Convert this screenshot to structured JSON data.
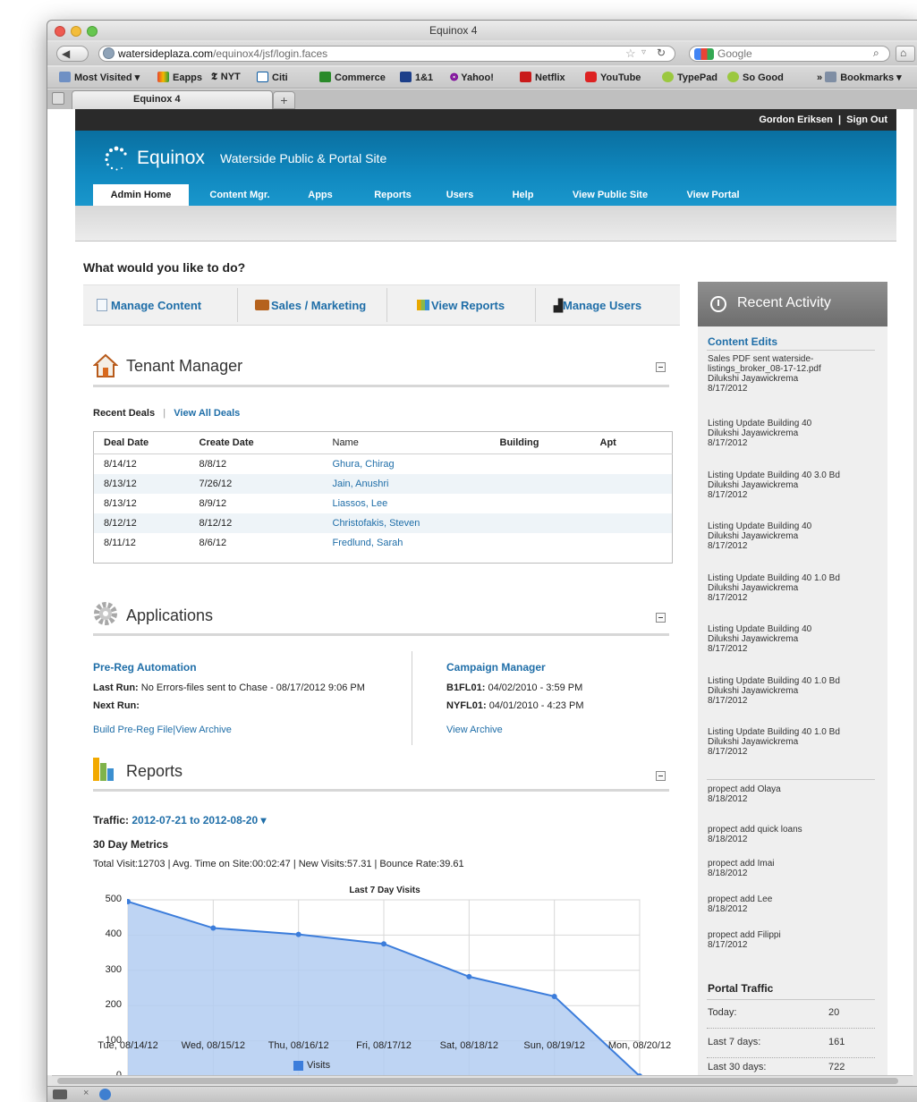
{
  "browser": {
    "window_title": "Equinox 4",
    "url_domain": "watersideplaza.com",
    "url_path": "/equinox4/jsf/login.faces",
    "search_engine": "Google",
    "tab_title": "Equinox 4",
    "bookmarks": [
      "Most Visited",
      "Eapps",
      "NYT",
      "Citi",
      "Commerce",
      "1&1",
      "Yahoo!",
      "Netflix",
      "YouTube",
      "TypePad",
      "So Good"
    ],
    "bookmarks_menu": "Bookmarks",
    "overflow": "»"
  },
  "topbar": {
    "user": "Gordon Eriksen",
    "separator": "|",
    "signout": "Sign Out"
  },
  "header": {
    "logo": "Equinox",
    "site_title": "Waterside Public & Portal Site"
  },
  "nav": [
    "Admin Home",
    "Content Mgr.",
    "Apps",
    "Reports",
    "Users",
    "Help",
    "View Public Site",
    "View Portal"
  ],
  "main": {
    "question": "What would you like to do?",
    "quick_actions": [
      "Manage Content",
      "Sales / Marketing",
      "View Reports",
      "Manage Users"
    ]
  },
  "tenant": {
    "title": "Tenant Manager",
    "recent_label": "Recent Deals",
    "sep": "|",
    "view_all": "View All Deals",
    "columns": [
      "Deal Date",
      "Create Date",
      "Name",
      "Building",
      "Apt"
    ],
    "rows": [
      {
        "deal": "8/14/12",
        "create": "8/8/12",
        "name": "Ghura, Chirag"
      },
      {
        "deal": "8/13/12",
        "create": "7/26/12",
        "name": "Jain, Anushri"
      },
      {
        "deal": "8/13/12",
        "create": "8/9/12",
        "name": "Liassos, Lee"
      },
      {
        "deal": "8/12/12",
        "create": "8/12/12",
        "name": "Christofakis, Steven"
      },
      {
        "deal": "8/11/12",
        "create": "8/6/12",
        "name": "Fredlund, Sarah"
      }
    ]
  },
  "apps": {
    "title": "Applications",
    "left": {
      "name": "Pre-Reg Automation",
      "last_run_label": "Last Run:",
      "last_run_value": "No Errors-files sent to Chase - 08/17/2012 9:06 PM",
      "next_run_label": "Next Run:",
      "link1": "Build Pre-Reg File",
      "pipe": "|",
      "link2": "View Archive"
    },
    "right": {
      "name": "Campaign Manager",
      "line1_label": "B1FL01:",
      "line1_value": "04/02/2010 - 3:59 PM",
      "line2_label": "NYFL01:",
      "line2_value": "04/01/2010 - 4:23 PM",
      "link": "View Archive"
    }
  },
  "reports": {
    "title": "Reports",
    "traffic_label": "Traffic:",
    "traffic_range": "2012-07-21 to 2012-08-20 ▾",
    "metrics_title": "30 Day Metrics",
    "metrics_line": "Total Visit:12703 | Avg. Time on Site:00:02:47 | New Visits:57.31 | Bounce Rate:39.61"
  },
  "chart_data": {
    "type": "area",
    "title": "Last 7 Day Visits",
    "categories": [
      "Tue, 08/14/12",
      "Wed, 08/15/12",
      "Thu, 08/16/12",
      "Fri, 08/17/12",
      "Sat, 08/18/12",
      "Sun, 08/19/12",
      "Mon, 08/20/12"
    ],
    "series": [
      {
        "name": "Visits",
        "values": [
          495,
          420,
          402,
          375,
          282,
          226,
          0
        ]
      }
    ],
    "ylim": [
      0,
      500
    ],
    "yticks": [
      "0",
      "100",
      "200",
      "300",
      "400",
      "500"
    ],
    "grid": true,
    "legend": "bottom",
    "colors": {
      "fill": "#b3cdf1",
      "line": "#3c7ddb"
    }
  },
  "sidebar": {
    "title": "Recent Activity",
    "content_edits_title": "Content Edits",
    "edits": [
      {
        "title": "Sales PDF sent waterside-",
        "title2": "listings_broker_08-17-12.pdf",
        "user": "Dilukshi Jayawickrema",
        "date": "8/17/2012"
      },
      {
        "title": "Listing Update Building 40",
        "user": "Dilukshi Jayawickrema",
        "date": "8/17/2012"
      },
      {
        "title": "Listing Update Building 40 3.0 Bd",
        "user": "Dilukshi Jayawickrema",
        "date": "8/17/2012"
      },
      {
        "title": "Listing Update Building 40",
        "user": "Dilukshi Jayawickrema",
        "date": "8/17/2012"
      },
      {
        "title": "Listing Update Building 40 1.0 Bd",
        "user": "Dilukshi Jayawickrema",
        "date": "8/17/2012"
      },
      {
        "title": "Listing Update Building 40",
        "user": "Dilukshi Jayawickrema",
        "date": "8/17/2012"
      },
      {
        "title": "Listing Update Building 40 1.0 Bd",
        "user": "Dilukshi Jayawickrema",
        "date": "8/17/2012"
      },
      {
        "title": "Listing Update Building 40 1.0 Bd",
        "user": "Dilukshi Jayawickrema",
        "date": "8/17/2012"
      }
    ],
    "prospects": [
      {
        "text": "propect add Olaya",
        "date": "8/18/2012"
      },
      {
        "text": "propect add quick loans",
        "date": "8/18/2012"
      },
      {
        "text": "propect add Imai",
        "date": "8/18/2012"
      },
      {
        "text": "propect add Lee",
        "date": "8/18/2012"
      },
      {
        "text": "propect add Filippi",
        "date": "8/17/2012"
      }
    ],
    "portal_title": "Portal Traffic",
    "traffic": [
      {
        "label": "Today:",
        "value": "20"
      },
      {
        "label": "Last 7 days:",
        "value": "161"
      },
      {
        "label": "Last 30 days:",
        "value": "722"
      }
    ]
  }
}
